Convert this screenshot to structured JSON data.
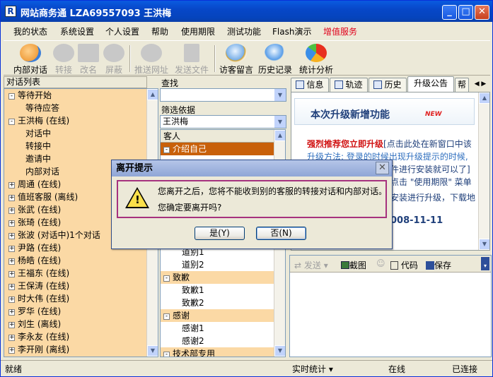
{
  "window": {
    "title": "网站商务通   LZA69557093 王洪梅",
    "icon_label": "R"
  },
  "menu": [
    "我的状态",
    "系统设置",
    "个人设置",
    "帮助",
    "使用期限",
    "测试功能",
    "Flash演示",
    "增值服务"
  ],
  "menu_highlight_color": "#e0001b",
  "toolbar": [
    {
      "label": "内部对话",
      "enabled": true
    },
    {
      "label": "转接",
      "enabled": false
    },
    {
      "label": "改名",
      "enabled": false
    },
    {
      "label": "屏蔽",
      "enabled": false
    },
    {
      "label": "推送网址",
      "enabled": false
    },
    {
      "label": "发送文件",
      "enabled": false
    },
    {
      "label": "访客留言",
      "enabled": true
    },
    {
      "label": "历史记录",
      "enabled": true
    },
    {
      "label": "统计分析",
      "enabled": true
    }
  ],
  "left_panel": {
    "header": "对话列表",
    "items": [
      {
        "label": "等待开始",
        "level": 0,
        "expander": "-"
      },
      {
        "label": "等待应答",
        "level": 1,
        "expander": ""
      },
      {
        "label": "王洪梅  (在线)",
        "level": 0,
        "expander": "-"
      },
      {
        "label": "对话中",
        "level": 1,
        "expander": ""
      },
      {
        "label": "转接中",
        "level": 1,
        "expander": ""
      },
      {
        "label": "邀请中",
        "level": 1,
        "expander": ""
      },
      {
        "label": "内部对话",
        "level": 1,
        "expander": ""
      },
      {
        "label": "周通  (在线)",
        "level": 0,
        "expander": "+"
      },
      {
        "label": "值班客服  (离线)",
        "level": 0,
        "expander": "+"
      },
      {
        "label": "张武  (在线)",
        "level": 0,
        "expander": "+"
      },
      {
        "label": "张琦  (在线)",
        "level": 0,
        "expander": "+"
      },
      {
        "label": "张波  (对话中)1个对话",
        "level": 0,
        "expander": "+"
      },
      {
        "label": "尹路  (在线)",
        "level": 0,
        "expander": "+"
      },
      {
        "label": "杨皓  (在线)",
        "level": 0,
        "expander": "+"
      },
      {
        "label": "王福东  (在线)",
        "level": 0,
        "expander": "+"
      },
      {
        "label": "王保涛  (在线)",
        "level": 0,
        "expander": "+"
      },
      {
        "label": "时大伟  (在线)",
        "level": 0,
        "expander": "+"
      },
      {
        "label": "罗华  (在线)",
        "level": 0,
        "expander": "+"
      },
      {
        "label": "刘生  (离线)",
        "level": 0,
        "expander": "+"
      },
      {
        "label": "李永友  (在线)",
        "level": 0,
        "expander": "+"
      },
      {
        "label": "李开刚  (离线)",
        "level": 0,
        "expander": "+"
      }
    ]
  },
  "mid_panel": {
    "search_label": "查找",
    "search_value": "",
    "filter_label": "筛选依据",
    "filter_value": "王洪梅",
    "list_header": "客人",
    "items": [
      {
        "label": "介绍自己",
        "type": "category",
        "selected": true
      },
      {
        "label": "道别1",
        "type": "item"
      },
      {
        "label": "道别2",
        "type": "item"
      },
      {
        "label": "致歉",
        "type": "category"
      },
      {
        "label": "致歉1",
        "type": "item"
      },
      {
        "label": "致歉2",
        "type": "item"
      },
      {
        "label": "感谢",
        "type": "category"
      },
      {
        "label": "感谢1",
        "type": "item"
      },
      {
        "label": "感谢2",
        "type": "item"
      },
      {
        "label": "技术部专用",
        "type": "category"
      }
    ],
    "selected_color": "#c8600a"
  },
  "right_panel": {
    "tabs": [
      "信息",
      "轨迹",
      "历史",
      "升级公告",
      "帮"
    ],
    "active_tab": "升级公告",
    "notice_title": "本次升级新增功能",
    "new_badge": "NEW",
    "notice_strong": "强烈推荐您立即升级",
    "notice_line1": "[点击此处在新窗口中该",
    "notice_line2": "升级方法: 登录的时候出现升级提示的时候,",
    "notice_line3": "件进行安装就可以了]",
    "notice_line4": "点击 \"使用期限\" 菜单",
    "notice_line5": "安装进行升级，下载地",
    "notice_date": "008-11-11",
    "send_bar": {
      "send": "发送",
      "screenshot": "截图",
      "code": "代码",
      "save": "保存"
    }
  },
  "status_bar": {
    "left": "就绪",
    "stats": "实时统计",
    "online": "在线",
    "connected": "已连接"
  },
  "dialog": {
    "title": "离开提示",
    "line1": "您离开之后，您将不能收到别的客服的转接对话和内部对话。",
    "line2": "您确定要离开吗?",
    "yes": "是(Y)",
    "no": "否(N)"
  }
}
